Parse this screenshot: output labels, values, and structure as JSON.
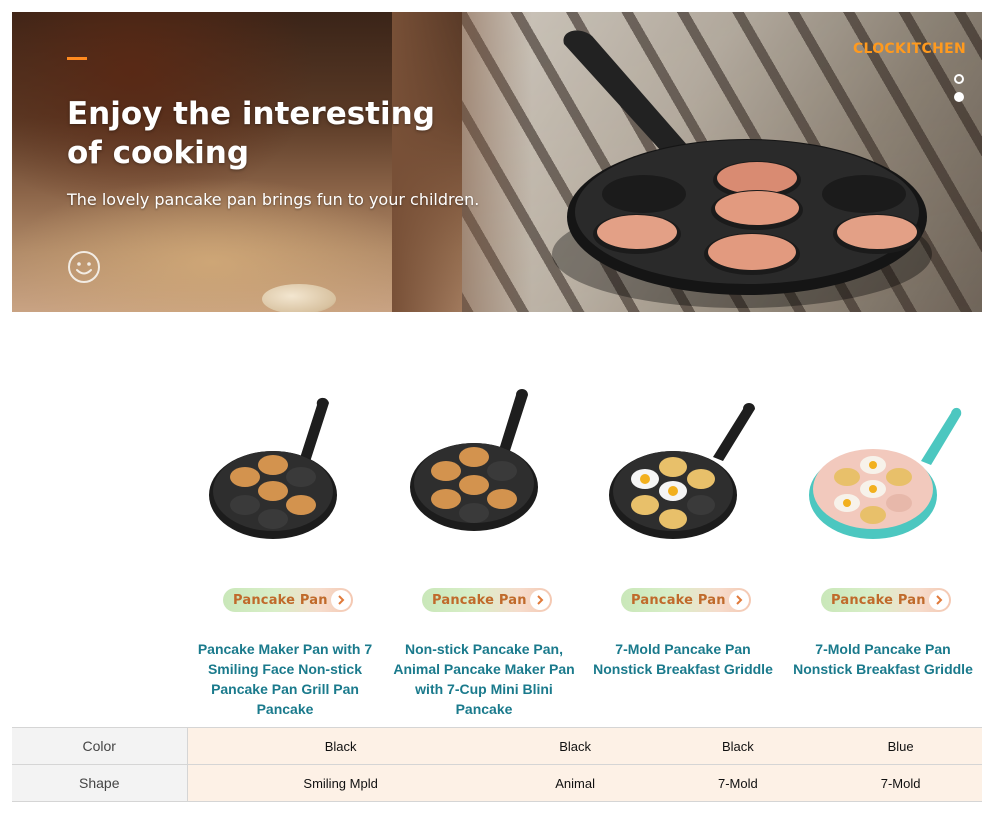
{
  "hero": {
    "title_line1": "Enjoy the interesting",
    "title_line2": "of cooking",
    "subtitle": "The lovely pancake pan brings fun to your children.",
    "brand": "CLOCKITCHEN",
    "smile_icon": "smiley-face-icon",
    "slide_dots": [
      {
        "state": "active"
      },
      {
        "state": "inactive"
      }
    ],
    "accent_color": "#ff8a1f"
  },
  "products": [
    {
      "pill_label": "Pancake Pan",
      "title": "Pancake Maker Pan with 7 Smiling Face Non-stick Pancake Pan Grill Pan Pancake",
      "color": "Black"
    },
    {
      "pill_label": "Pancake Pan",
      "title": "Non-stick Pancake Pan, Animal Pancake Maker Pan with 7-Cup Mini Blini Pancake",
      "color": "Black"
    },
    {
      "pill_label": "Pancake Pan",
      "title": "7-Mold Pancake Pan Nonstick Breakfast Griddle",
      "color": "Black"
    },
    {
      "pill_label": "Pancake Pan",
      "title": "7-Mold Pancake Pan Nonstick Breakfast Griddle",
      "color": "Blue"
    }
  ],
  "comparison": {
    "rows": [
      {
        "label": "Color",
        "values": [
          "Black",
          "Black",
          "Black",
          "Blue"
        ]
      },
      {
        "label": "Shape",
        "values": [
          "Smiling Mpld",
          "Animal",
          "7-Mold",
          "7-Mold"
        ]
      }
    ]
  },
  "colors": {
    "title_link": "#1a7a8c",
    "pill_text": "#c06a2b",
    "table_cell_bg": "#fdf1e6",
    "brand": "#ff9a1e"
  }
}
